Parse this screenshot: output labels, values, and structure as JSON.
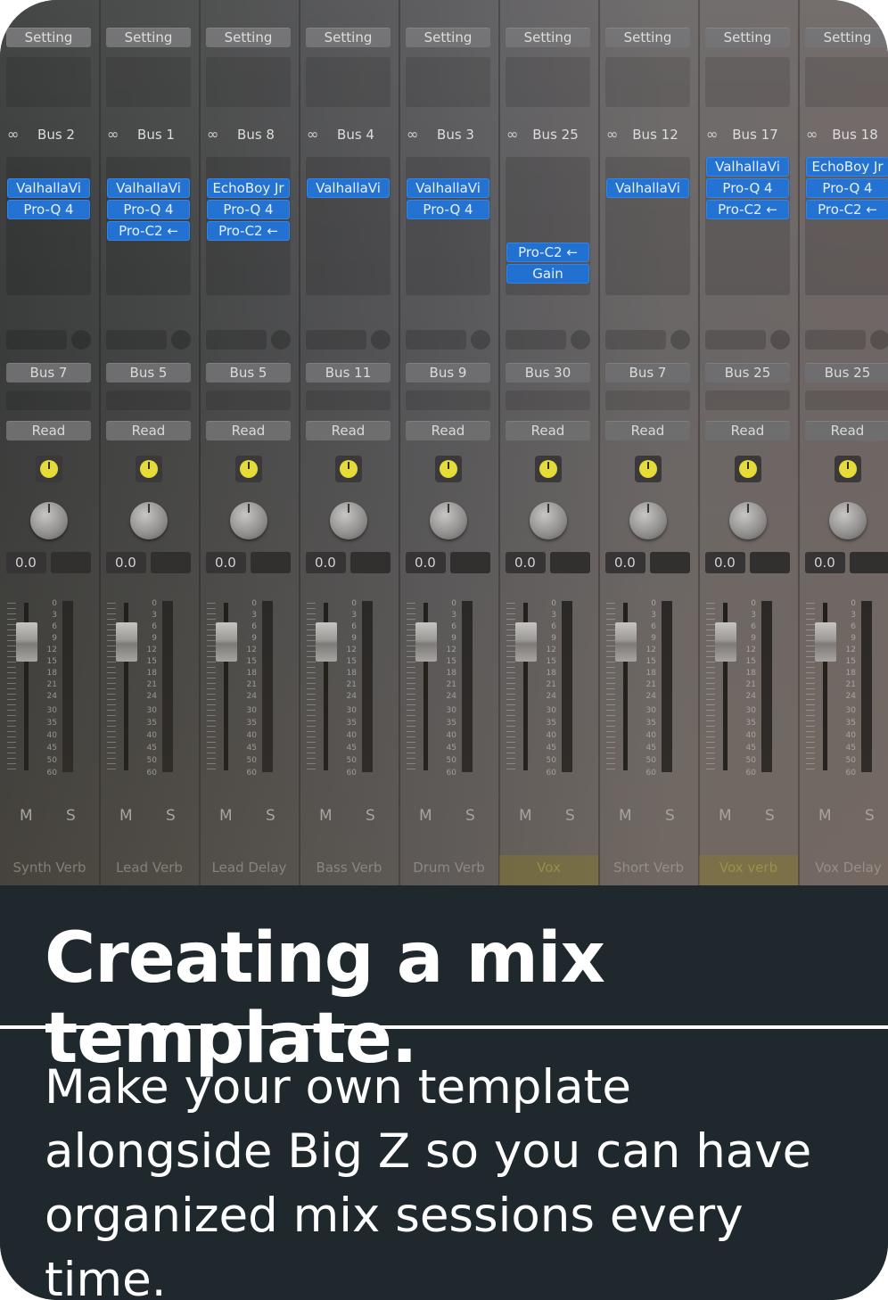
{
  "strips": [
    {
      "setting": "Setting",
      "bus_in": "Bus 2",
      "plugins": [
        "ValhallaVi",
        "Pro-Q 4"
      ],
      "output": "Bus 7",
      "automation": "Read",
      "volume": "0.0",
      "mute": "M",
      "solo": "S",
      "name": "Synth Verb",
      "highlight": false
    },
    {
      "setting": "Setting",
      "bus_in": "Bus 1",
      "plugins": [
        "ValhallaVi",
        "Pro-Q 4",
        "Pro-C2 ←"
      ],
      "output": "Bus 5",
      "automation": "Read",
      "volume": "0.0",
      "mute": "M",
      "solo": "S",
      "name": "Lead Verb",
      "highlight": false
    },
    {
      "setting": "Setting",
      "bus_in": "Bus 8",
      "plugins": [
        "EchoBoy Jr",
        "Pro-Q 4",
        "Pro-C2 ←"
      ],
      "output": "Bus 5",
      "automation": "Read",
      "volume": "0.0",
      "mute": "M",
      "solo": "S",
      "name": "Lead Delay",
      "highlight": false
    },
    {
      "setting": "Setting",
      "bus_in": "Bus 4",
      "plugins": [
        "ValhallaVi"
      ],
      "output": "Bus 11",
      "automation": "Read",
      "volume": "0.0",
      "mute": "M",
      "solo": "S",
      "name": "Bass Verb",
      "highlight": false
    },
    {
      "setting": "Setting",
      "bus_in": "Bus 3",
      "plugins": [
        "ValhallaVi",
        "Pro-Q 4"
      ],
      "output": "Bus 9",
      "automation": "Read",
      "volume": "0.0",
      "mute": "M",
      "solo": "S",
      "name": "Drum Verb",
      "highlight": false
    },
    {
      "setting": "Setting",
      "bus_in": "Bus 25",
      "plugins": [
        "",
        "",
        "",
        "Pro-C2 ←",
        "Gain"
      ],
      "output": "Bus 30",
      "automation": "Read",
      "volume": "0.0",
      "mute": "M",
      "solo": "S",
      "name": "Vox",
      "highlight": true
    },
    {
      "setting": "Setting",
      "bus_in": "Bus 12",
      "plugins": [
        "ValhallaVi"
      ],
      "output": "Bus 7",
      "automation": "Read",
      "volume": "0.0",
      "mute": "M",
      "solo": "S",
      "name": "Short Verb",
      "highlight": false
    },
    {
      "setting": "Setting",
      "bus_in": "Bus 17",
      "plugins": [
        "ValhallaVi",
        "Pro-Q 4",
        "Pro-C2 ←"
      ],
      "output": "Bus 25",
      "automation": "Read",
      "volume": "0.0",
      "mute": "M",
      "solo": "S",
      "name": "Vox verb",
      "highlight": true
    },
    {
      "setting": "Setting",
      "bus_in": "Bus 18",
      "plugins": [
        "EchoBoy Jr",
        "Pro-Q 4",
        "Pro-C2 ←"
      ],
      "output": "Bus 25",
      "automation": "Read",
      "volume": "0.0",
      "mute": "M",
      "solo": "S",
      "name": "Vox Delay",
      "highlight": false
    }
  ],
  "fader_scale": [
    "0",
    "3",
    "6",
    "9",
    "12",
    "15",
    "18",
    "21",
    "24",
    "30",
    "35",
    "40",
    "45",
    "50",
    "60"
  ],
  "icons": {
    "link": "link-icon",
    "pan": "pan-knob",
    "power": "power-icon"
  },
  "colors": {
    "plugin_blue": "#1f6fd0",
    "power_yellow": "#e7df3a",
    "card_bg": "#1f282d"
  },
  "caption": {
    "title": "Creating a mix template.",
    "body": "Make your own template alongside Big Z so you can have organized mix sessions every time."
  }
}
